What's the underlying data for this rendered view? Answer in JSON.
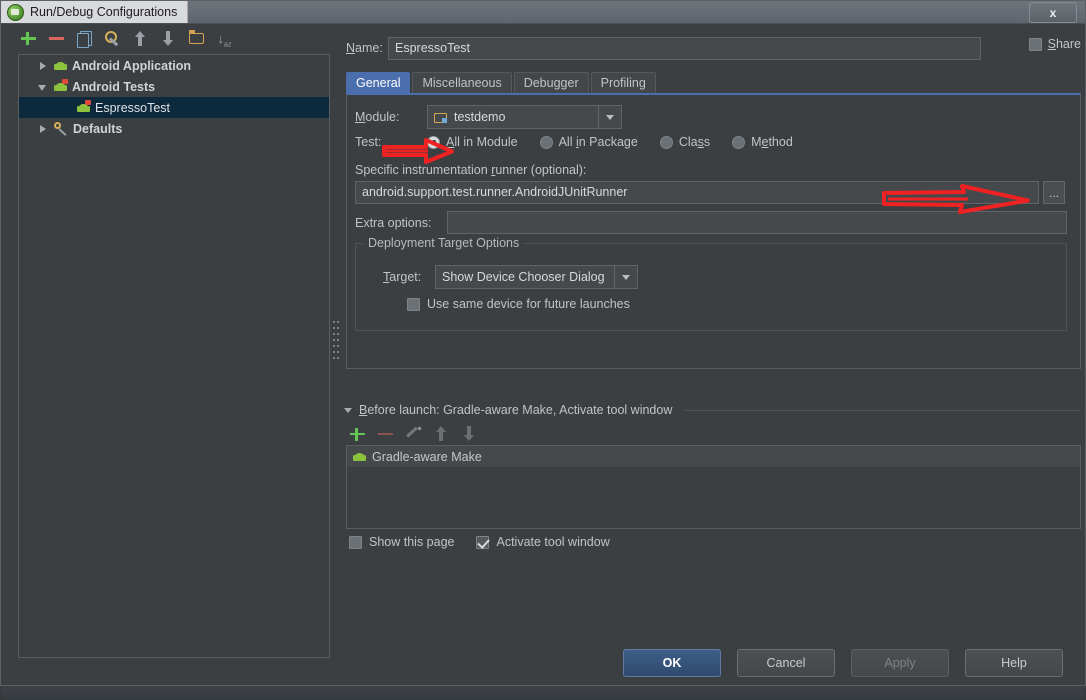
{
  "window": {
    "title": "Run/Debug Configurations",
    "app_icon": "android-studio-icon",
    "close_label": "x"
  },
  "left_panel": {
    "toolbar": [
      {
        "name": "add-configuration-button",
        "icon": "plus-icon",
        "label": "+"
      },
      {
        "name": "remove-configuration-button",
        "icon": "minus-icon",
        "label": "−"
      },
      {
        "name": "copy-configuration-button",
        "icon": "copy-icon",
        "label": ""
      },
      {
        "name": "edit-defaults-button",
        "icon": "wrench-icon",
        "label": ""
      },
      {
        "name": "move-up-button",
        "icon": "arrow-up-icon",
        "label": ""
      },
      {
        "name": "move-down-button",
        "icon": "arrow-down-icon",
        "label": ""
      },
      {
        "name": "create-folder-button",
        "icon": "folder-icon",
        "label": ""
      },
      {
        "name": "sort-configurations-button",
        "icon": "sort-az-icon",
        "label": "↓ᵃᶻ"
      }
    ],
    "tree": [
      {
        "label": "Android Application",
        "icon": "android-icon",
        "twisty": "closed",
        "selected": false,
        "indent": 0,
        "bold": true
      },
      {
        "label": "Android Tests",
        "icon": "android-test-icon",
        "twisty": "open",
        "selected": false,
        "indent": 0,
        "bold": true
      },
      {
        "label": "EspressoTest",
        "icon": "android-test-icon",
        "twisty": "none",
        "selected": true,
        "indent": 1,
        "bold": false
      },
      {
        "label": "Defaults",
        "icon": "wrench-icon",
        "twisty": "closed",
        "selected": false,
        "indent": 0,
        "bold": true
      }
    ]
  },
  "right_panel": {
    "name_label": "Name:",
    "name_value": "EspressoTest",
    "share_label": "Share",
    "share_checked": false,
    "tabs": [
      {
        "label": "General",
        "active": true
      },
      {
        "label": "Miscellaneous",
        "active": false
      },
      {
        "label": "Debugger",
        "active": false
      },
      {
        "label": "Profiling",
        "active": false
      }
    ],
    "general": {
      "module_label": "Module:",
      "module_value": "testdemo",
      "module_icon": "module-folder-icon",
      "test_label": "Test:",
      "test_options": [
        {
          "label": "All in Module",
          "selected": true
        },
        {
          "label": "All in Package",
          "selected": false
        },
        {
          "label": "Class",
          "selected": false
        },
        {
          "label": "Method",
          "selected": false
        }
      ],
      "runner_label": "Specific instrumentation runner (optional):",
      "runner_value": "android.support.test.runner.AndroidJUnitRunner",
      "runner_browse_label": "...",
      "extra_options_label": "Extra options:",
      "extra_options_value": "",
      "deployment_group_label": "Deployment Target Options",
      "target_label": "Target:",
      "target_value": "Show Device Chooser Dialog",
      "same_device_label": "Use same device for future launches",
      "same_device_checked": false
    }
  },
  "before_launch": {
    "header": "Before launch: Gradle-aware Make, Activate tool window",
    "toolbar": [
      {
        "name": "add-task-button",
        "icon": "plus-icon"
      },
      {
        "name": "remove-task-button",
        "icon": "minus-icon"
      },
      {
        "name": "edit-task-button",
        "icon": "pencil-icon"
      },
      {
        "name": "move-task-up-button",
        "icon": "arrow-up-icon"
      },
      {
        "name": "move-task-down-button",
        "icon": "arrow-down-icon"
      }
    ],
    "tasks": [
      {
        "label": "Gradle-aware Make",
        "icon": "android-icon"
      }
    ],
    "show_page_label": "Show this page",
    "show_page_checked": false,
    "activate_tool_window_label": "Activate tool window",
    "activate_tool_window_checked": true
  },
  "buttons": [
    {
      "label": "OK",
      "name": "ok-button",
      "style": "primary",
      "disabled": false
    },
    {
      "label": "Cancel",
      "name": "cancel-button",
      "style": "default",
      "disabled": false
    },
    {
      "label": "Apply",
      "name": "apply-button",
      "style": "default",
      "disabled": true
    },
    {
      "label": "Help",
      "name": "help-button",
      "style": "default",
      "disabled": false
    }
  ],
  "annotations": {
    "arrow_color": "#ee2222",
    "arrows": [
      {
        "name": "arrow-to-all-in-module-radio"
      },
      {
        "name": "arrow-to-runner-browse-button"
      }
    ]
  },
  "colors": {
    "background": "#3c3f41",
    "selection": "#0d293e",
    "accent": "#4b6eaf",
    "text": "#bfc4c8",
    "annotation_red": "#ee2222"
  }
}
